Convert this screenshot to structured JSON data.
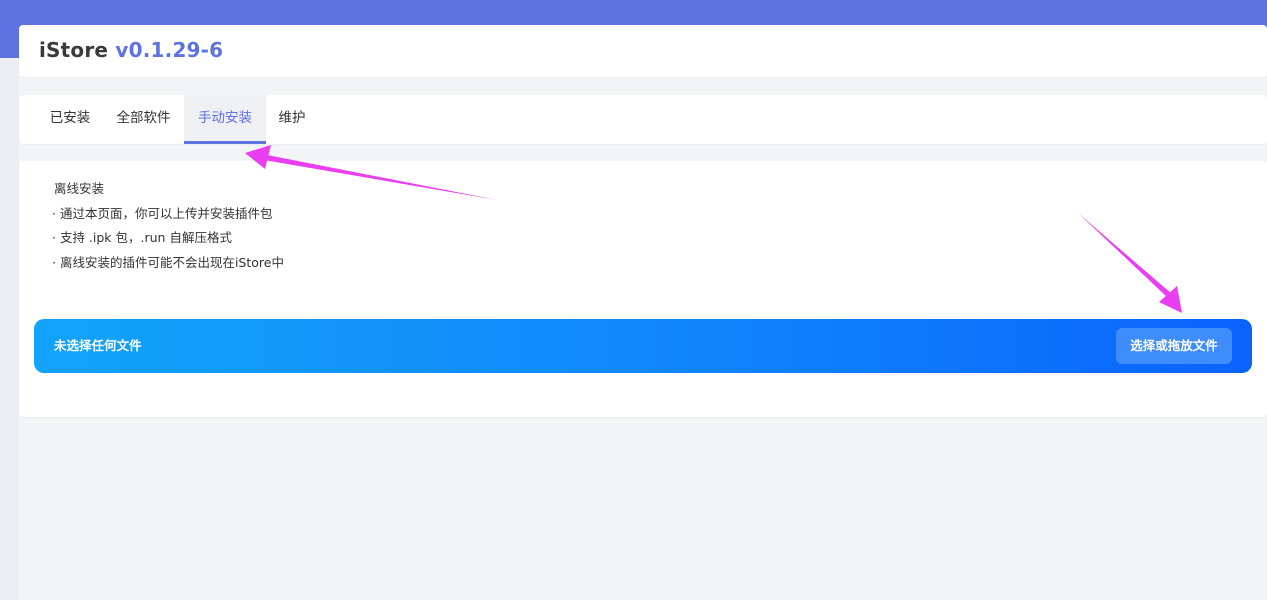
{
  "app": {
    "name": "iStore",
    "version": "v0.1.29-6"
  },
  "tabs": [
    {
      "label": "已安装",
      "active": false
    },
    {
      "label": "全部软件",
      "active": false
    },
    {
      "label": "手动安装",
      "active": true
    },
    {
      "label": "维护",
      "active": false
    }
  ],
  "manual_install": {
    "heading": "离线安装",
    "notes": [
      "· 通过本页面，你可以上传并安装插件包",
      "· 支持 .ipk 包，.run 自解压格式",
      "· 离线安装的插件可能不会出现在iStore中"
    ],
    "file_status": "未选择任何文件",
    "choose_button_label": "选择或拖放文件"
  },
  "colors": {
    "accent": "#5f72e2",
    "upload_gradient_start": "#12a3fb",
    "upload_gradient_end": "#0a63fd",
    "annotation_arrow": "#e93ff0"
  },
  "annotations": [
    "arrow-to-manual-install-tab",
    "arrow-to-choose-file-button"
  ]
}
